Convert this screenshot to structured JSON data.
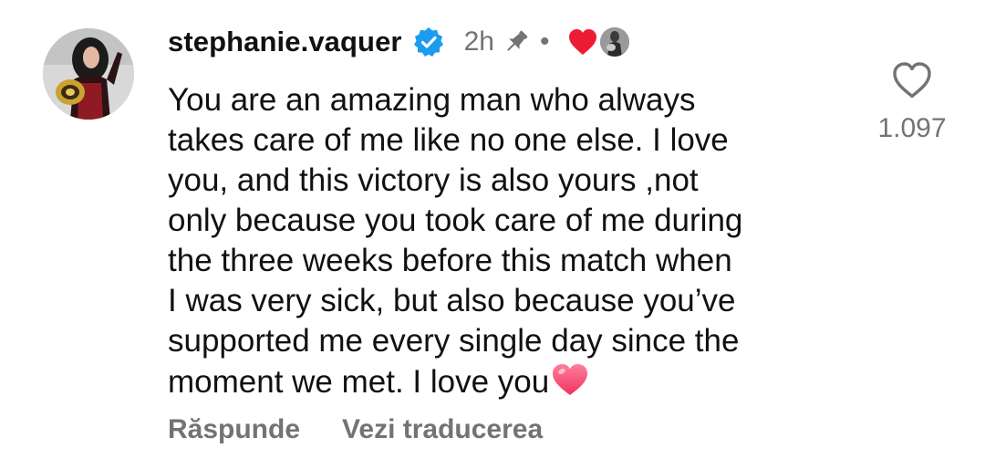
{
  "comment": {
    "username": "stephanie.vaquer",
    "verified": true,
    "time": "2h",
    "separator": "•",
    "pinned": true,
    "liked_by_author": true,
    "text_lines": [
      "You are an amazing man who always",
      "takes care of me like no one else. I love",
      "you, and this victory is also yours ,not",
      "only because you took care of me during",
      "the three weeks before this match when",
      "I was very sick, but also because you’ve",
      "supported me every single day since the",
      "moment we met. I love you"
    ],
    "like_count": "1.097",
    "actions": {
      "reply": "Răspunde",
      "translate": "Vezi traducerea"
    },
    "icons": {
      "verified": "verified-badge-icon",
      "pin": "pin-icon",
      "author_like": "red-heart-icon",
      "like": "heart-outline-icon",
      "emoji": "pink-heart-emoji-icon"
    },
    "colors": {
      "verified_blue": "#1D9BF0",
      "heart_red": "#ED1C35",
      "muted_gray": "#737373",
      "text": "#111111"
    }
  }
}
